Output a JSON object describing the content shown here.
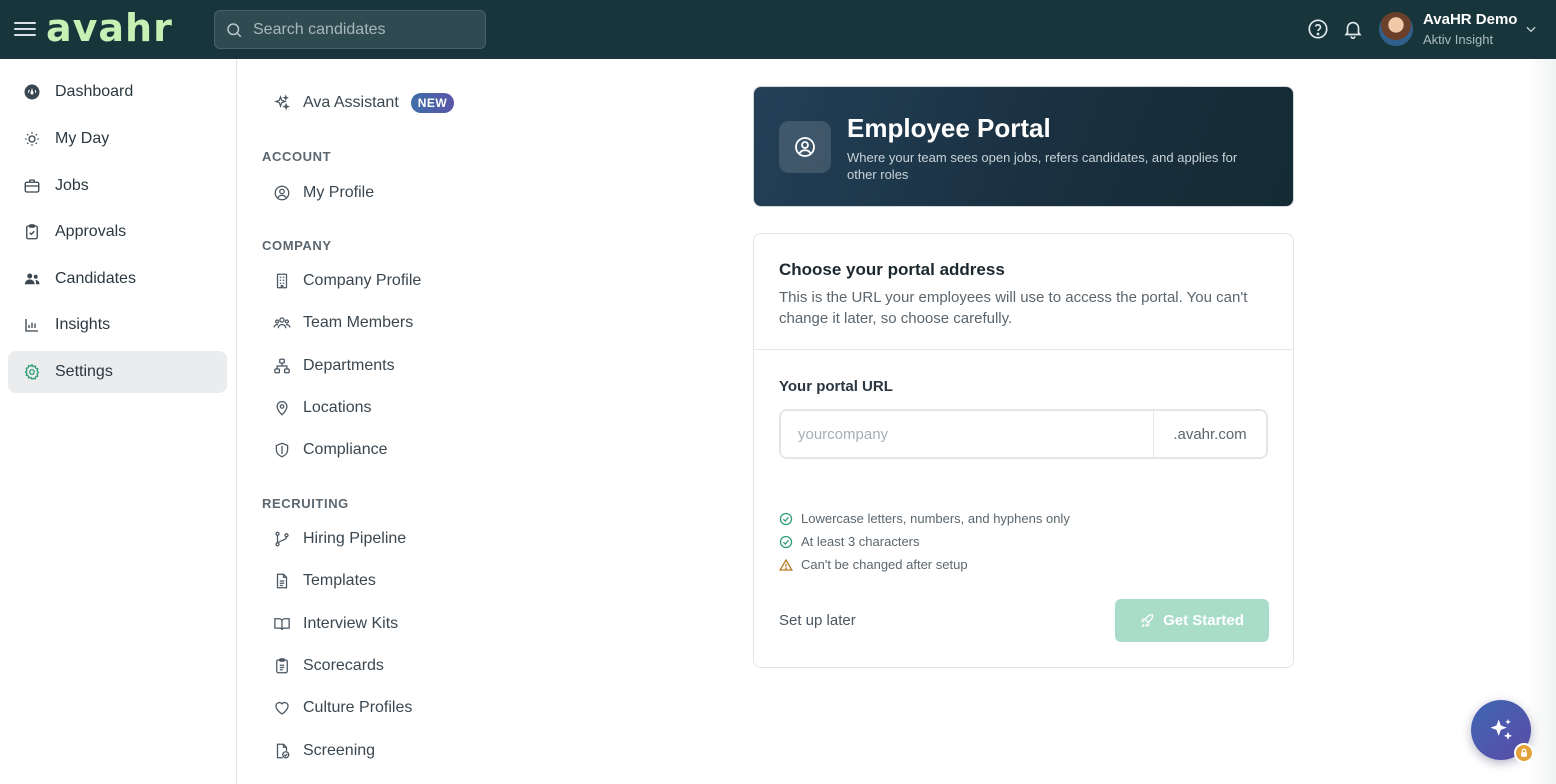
{
  "topbar": {
    "logo": "avahr",
    "search_placeholder": "Search candidates",
    "user_name": "AvaHR Demo",
    "user_org": "Aktiv Insight"
  },
  "nav": {
    "items": [
      {
        "label": "Dashboard",
        "icon": "dashboard-icon"
      },
      {
        "label": "My Day",
        "icon": "sun-icon"
      },
      {
        "label": "Jobs",
        "icon": "briefcase-icon"
      },
      {
        "label": "Approvals",
        "icon": "clipboard-check-icon"
      },
      {
        "label": "Candidates",
        "icon": "users-icon"
      },
      {
        "label": "Insights",
        "icon": "bar-chart-icon"
      },
      {
        "label": "Settings",
        "icon": "gear-icon",
        "active": true
      }
    ]
  },
  "settings": {
    "assistant_label": "Ava Assistant",
    "assistant_badge": "NEW",
    "account_heading": "ACCOUNT",
    "my_profile": "My Profile",
    "company_heading": "COMPANY",
    "company_items": [
      "Company Profile",
      "Team Members",
      "Departments",
      "Locations",
      "Compliance"
    ],
    "recruiting_heading": "RECRUITING",
    "recruiting_items": [
      "Hiring Pipeline",
      "Templates",
      "Interview Kits",
      "Scorecards",
      "Culture Profiles",
      "Screening"
    ]
  },
  "hero": {
    "title": "Employee Portal",
    "subtitle": "Where your team sees open jobs, refers candidates, and applies for other roles"
  },
  "form": {
    "title": "Choose your portal address",
    "description": "This is the URL your employees will use to access the portal. You can't change it later, so choose carefully.",
    "field_label": "Your portal URL",
    "url_placeholder": "yourcompany",
    "url_value": "",
    "url_suffix": ".avahr.com",
    "rules": [
      {
        "text": "Lowercase letters, numbers, and hyphens only",
        "status": "ok"
      },
      {
        "text": "At least 3 characters",
        "status": "ok"
      },
      {
        "text": "Can't be changed after setup",
        "status": "warning"
      }
    ],
    "later_label": "Set up later",
    "submit_label": "Get Started"
  },
  "colors": {
    "topbar": "#17353b",
    "logo": "#c8f0b5",
    "accent": "#2f9e74",
    "button_disabled": "#a9dcc9",
    "warning": "#b7791f"
  }
}
